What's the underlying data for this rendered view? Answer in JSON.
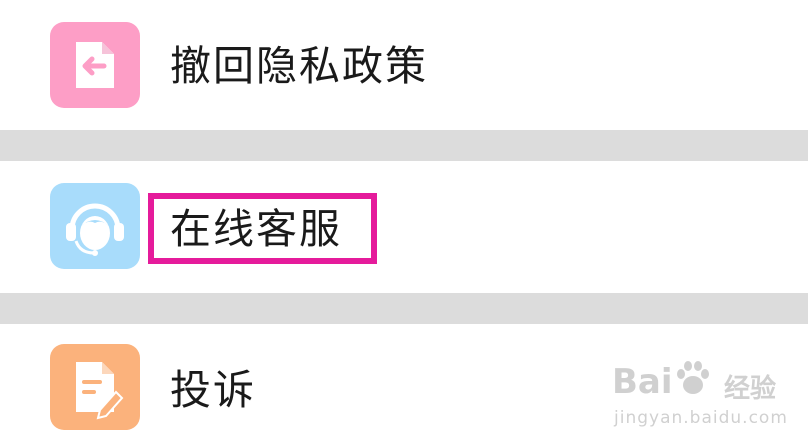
{
  "menu": {
    "items": [
      {
        "label": "撤回隐私政策",
        "icon": "revoke-document-icon",
        "icon_color": "#fd9ec6"
      },
      {
        "label": "在线客服",
        "icon": "customer-service-headset-icon",
        "icon_color": "#a8dcfb"
      },
      {
        "label": "投诉",
        "icon": "complaint-edit-document-icon",
        "icon_color": "#fbb27c"
      }
    ]
  },
  "highlight": {
    "color": "#e51b9b"
  },
  "watermark": {
    "brand_left": "Bai",
    "brand_right": "经验",
    "url": "jingyan.baidu.com"
  }
}
